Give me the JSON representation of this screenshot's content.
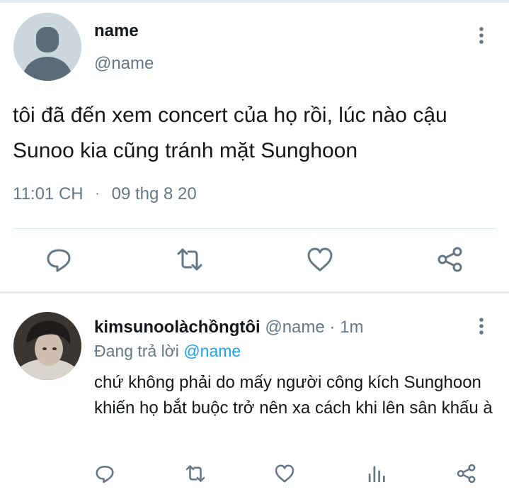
{
  "main_tweet": {
    "name": "name",
    "handle": "@name",
    "text": "tôi đã đến xem concert của họ rồi, lúc nào cậu Sunoo kia cũng tránh mặt Sunghoon",
    "time": "11:01 CH",
    "dot": "·",
    "date": "09 thg 8 20"
  },
  "reply": {
    "name": "kimsunoolàchồngtôi",
    "handle": "@name",
    "dot": "·",
    "age": "1m",
    "replying_prefix": "Đang trả lời",
    "replying_to": "@name",
    "text": "chứ không phải do mấy người công kích Sunghoon khiến họ bắt buộc trở nên xa cách khi lên sân khấu à"
  },
  "icons": {
    "reply": "speech-bubble-icon",
    "retweet": "retweet-arrows-icon",
    "like": "heart-icon",
    "share": "share-icon",
    "analytics": "bar-chart-icon",
    "more": "vertical-dots-icon"
  },
  "colors": {
    "text": "#14171a",
    "secondary": "#657786",
    "link": "#1da1f2",
    "divider": "#e1e8ed"
  }
}
